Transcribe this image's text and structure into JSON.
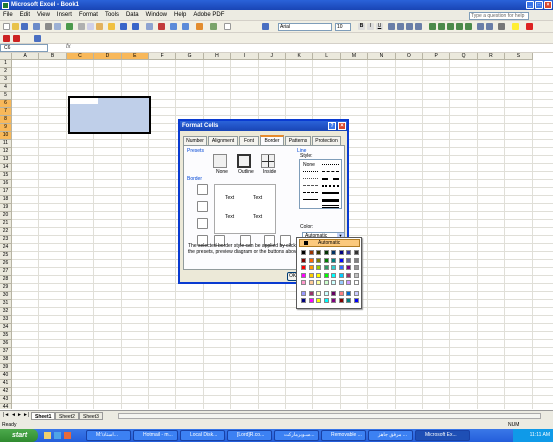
{
  "window": {
    "title": "Microsoft Excel - Book1"
  },
  "menu": [
    "File",
    "Edit",
    "View",
    "Insert",
    "Format",
    "Tools",
    "Data",
    "Window",
    "Help",
    "Adobe PDF"
  ],
  "help_placeholder": "Type a question for help",
  "font": {
    "name": "Arial",
    "size": "10"
  },
  "namebox": "C6",
  "fx": "fx",
  "columns": [
    "A",
    "B",
    "C",
    "D",
    "E",
    "F",
    "G",
    "H",
    "I",
    "J",
    "K",
    "L",
    "M",
    "N",
    "O",
    "P",
    "Q",
    "R",
    "S"
  ],
  "rows": [
    "1",
    "2",
    "3",
    "4",
    "5",
    "6",
    "7",
    "8",
    "9",
    "10",
    "11",
    "12",
    "13",
    "14",
    "15",
    "16",
    "17",
    "18",
    "19",
    "20",
    "21",
    "22",
    "23",
    "24",
    "25",
    "26",
    "27",
    "28",
    "29",
    "30",
    "31",
    "32",
    "33",
    "34",
    "35",
    "36",
    "37",
    "38",
    "39",
    "40",
    "41",
    "42",
    "43",
    "44"
  ],
  "sheets": [
    "Sheet1",
    "Sheet2",
    "Sheet3"
  ],
  "status": {
    "left": "Ready",
    "right": "NUM"
  },
  "taskbar": {
    "start": "start",
    "items": [
      "M:\\استاذ...",
      "Hotmail - m...",
      "Local Disk...",
      "[Lord]R.co...",
      "سـوبرماركت...",
      "Removable ...",
      "مرفق جاهز ...",
      "Microsoft Ex..."
    ],
    "clock": "11:11 AM"
  },
  "dialog": {
    "title": "Format Cells",
    "tabs": [
      "Number",
      "Alignment",
      "Font",
      "Border",
      "Patterns",
      "Protection"
    ],
    "presets_label": "Presets",
    "presets": [
      "None",
      "Outline",
      "Inside"
    ],
    "border_label": "Border",
    "line_label": "Line",
    "style_label": "Style:",
    "style_none": "None",
    "preview_text": "Text",
    "color_label": "Color:",
    "color_value": "Automatic",
    "note": "The selected border style can be applied by clicking the presets, preview diagram or the buttons above.",
    "ok": "OK"
  },
  "palette": {
    "auto_label": "Automatic",
    "colors": [
      "#000000",
      "#993300",
      "#333300",
      "#003300",
      "#003366",
      "#000080",
      "#333399",
      "#333333",
      "#800000",
      "#ff6600",
      "#808000",
      "#008000",
      "#008080",
      "#0000ff",
      "#666699",
      "#808080",
      "#ff0000",
      "#ff9900",
      "#99cc00",
      "#339966",
      "#33cccc",
      "#3366ff",
      "#800080",
      "#969696",
      "#ff00ff",
      "#ffcc00",
      "#ffff00",
      "#00ff00",
      "#00ffff",
      "#00ccff",
      "#993366",
      "#c0c0c0",
      "#ff99cc",
      "#ffcc99",
      "#ffff99",
      "#ccffcc",
      "#ccffff",
      "#99ccff",
      "#cc99ff",
      "#ffffff",
      "#9999ff",
      "#993366",
      "#ffffcc",
      "#ccffff",
      "#660066",
      "#ff8080",
      "#0066cc",
      "#ccccff",
      "#000080",
      "#ff00ff",
      "#ffff00",
      "#00ffff",
      "#800080",
      "#800000",
      "#008080",
      "#0000ff"
    ]
  }
}
